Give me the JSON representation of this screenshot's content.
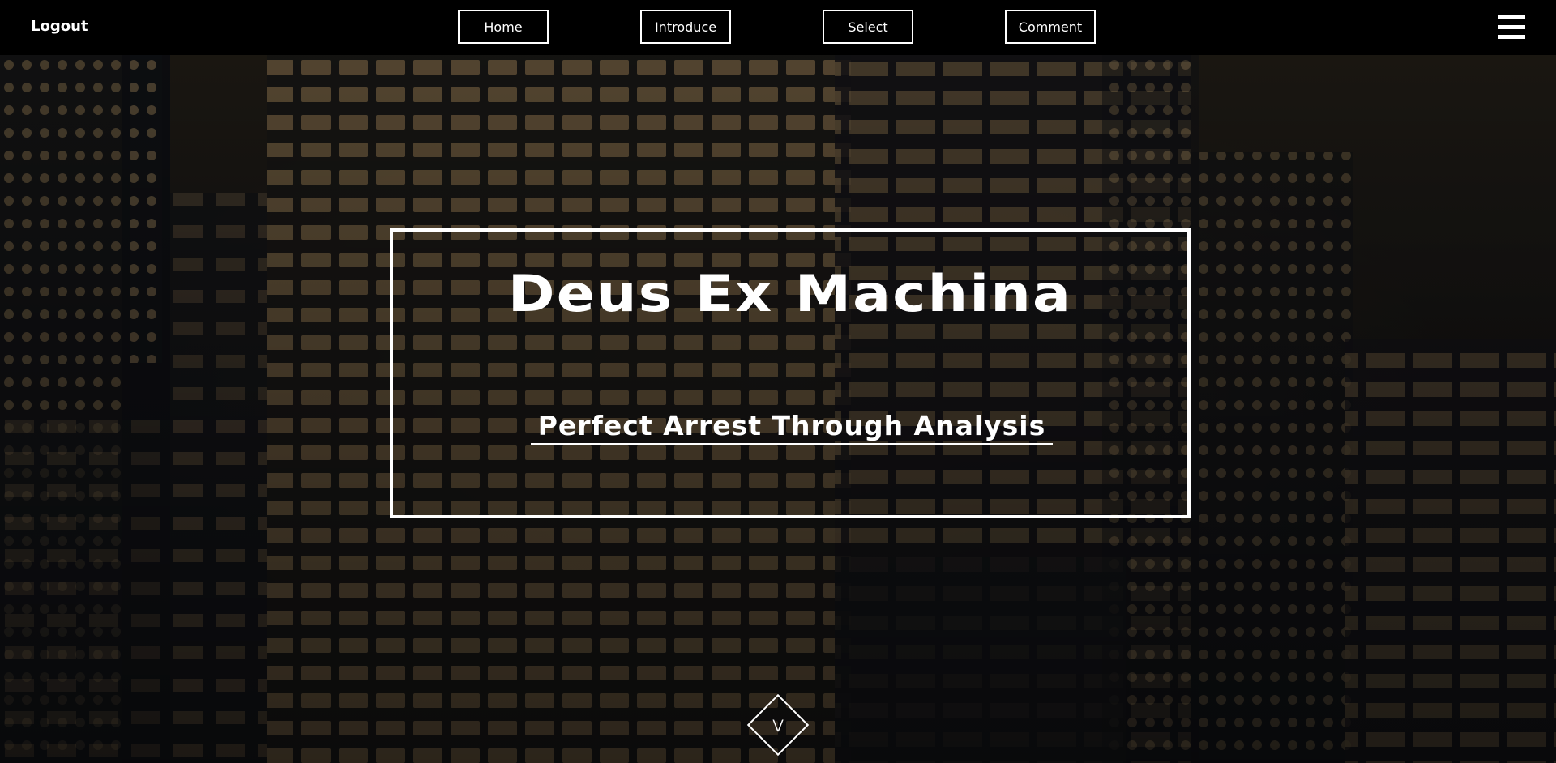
{
  "nav": {
    "logout_label": "Logout",
    "items": [
      {
        "label": "Home"
      },
      {
        "label": "Introduce"
      },
      {
        "label": "Select"
      },
      {
        "label": "Comment"
      }
    ],
    "menu_icon": "hamburger-menu-icon"
  },
  "hero": {
    "title": "Deus Ex Machina",
    "subtitle": "Perfect Arrest Through Analysis",
    "scroll_icon": "double-chevron-down-icon",
    "background_image": "night city skyline with lit office windows"
  },
  "colors": {
    "topbar": "#000000",
    "text": "#ffffff",
    "window_light": "#c9a36a"
  }
}
